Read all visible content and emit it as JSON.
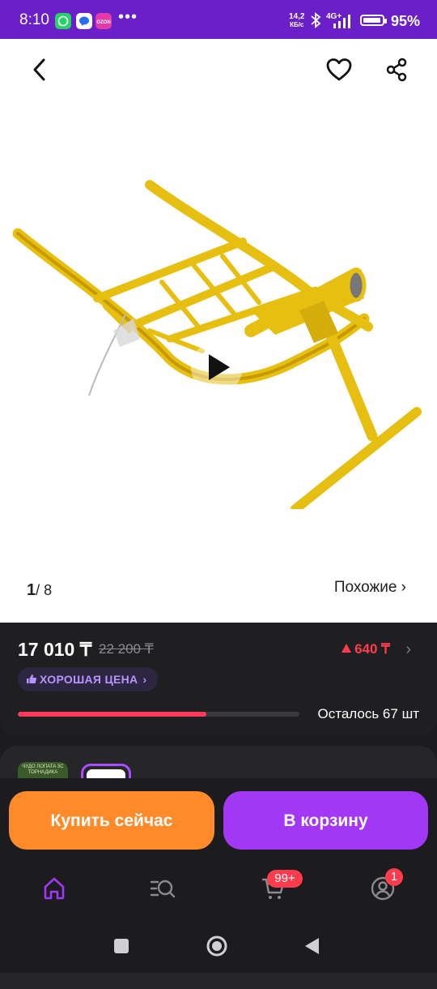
{
  "status_bar": {
    "time": "8:10",
    "more": "•••",
    "net_speed": "14,2",
    "net_unit": "КБ/с",
    "network": "4G+",
    "battery_pct": "95%",
    "battery_level": 0.95
  },
  "gallery": {
    "counter_current": "1",
    "counter_sep": "/ 8",
    "similar_label": "Похожие ›"
  },
  "price": {
    "current": "17 010 ₸",
    "old": "22 200 ₸",
    "diff": "640 ₸",
    "badge_label": "ХОРОШАЯ ЦЕНА",
    "stock_label": "Осталось 67 шт",
    "stock_progress": 0.67,
    "diff_color": "#ff3b4e"
  },
  "thumbnails": {
    "thumb1_caption": "ЧУДО ЛОПАТА 3С ТОРНАДИКА"
  },
  "actions": {
    "buy_now": "Купить сейчас",
    "add_to_cart": "В корзину",
    "buy_color": "#ff8a2a",
    "cart_color": "#a237f5"
  },
  "tabbar": {
    "cart_count": "99+",
    "profile_count": "1",
    "active_color": "#a237f5"
  }
}
